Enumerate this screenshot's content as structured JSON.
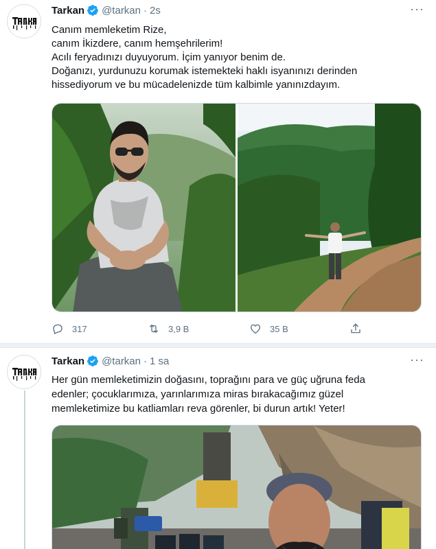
{
  "tweets": [
    {
      "name": "Tarkan",
      "handle": "@tarkan",
      "separator": "·",
      "time": "2s",
      "lines": [
        "Canım memleketim Rize,",
        "canım İkizdere, canım hemşehrilerim!",
        "Acılı feryadınızı duyuyorum. İçim yanıyor benim de.",
        "Doğanızı, yurdunuzu korumak istemekteki haklı isyanınızı derinden",
        "hissediyorum ve bu mücadelenizde tüm kalbimle yanınızdayım."
      ],
      "actions": {
        "reply_count": "317",
        "retweet_count": "3,9 B",
        "like_count": "35 B"
      }
    },
    {
      "name": "Tarkan",
      "handle": "@tarkan",
      "separator": "·",
      "time": "1 sa",
      "lines": [
        "Her gün memleketimizin doğasını, toprağını para ve güç uğruna feda",
        "edenler; çocuklarımıza, yarınlarımıza miras bırakacağımız güzel",
        "memleketimize bu katliamları reva görenler, bi durun artık! Yeter!"
      ]
    }
  ],
  "icons": {
    "more": "more-horizontal-icon",
    "reply": "reply-icon",
    "retweet": "retweet-icon",
    "like": "heart-icon",
    "share": "share-icon",
    "verified": "verified-badge-icon"
  },
  "colors": {
    "verified": "#1da1f2",
    "secondary_text": "#5b7083",
    "text": "#0f1419",
    "thread_line": "#c9d3db"
  }
}
